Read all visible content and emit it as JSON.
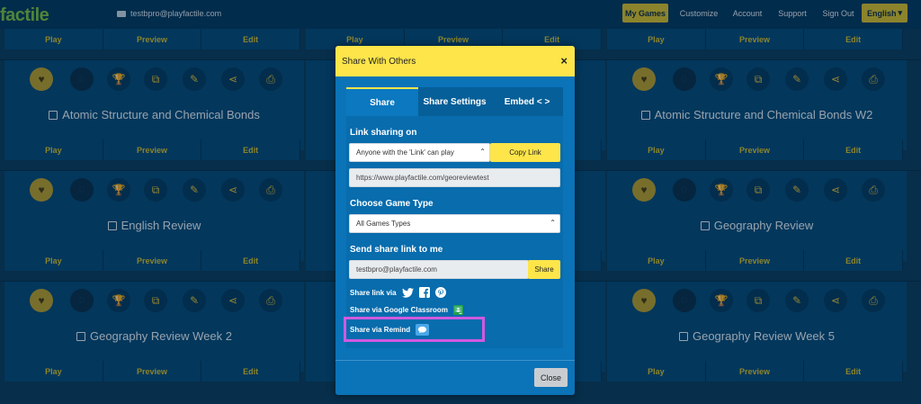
{
  "nav": {
    "logo": "factile",
    "email": "testbpro@playfactile.com",
    "links": [
      "My Games",
      "Customize",
      "Account",
      "Support",
      "Sign Out"
    ],
    "language": "English"
  },
  "card_actions": [
    "Play",
    "Preview",
    "Edit"
  ],
  "cards_left": [
    {
      "title": "Atomic Structure and Chemical Bonds"
    },
    {
      "title": "English Review"
    },
    {
      "title": "Geography Review Week 2"
    }
  ],
  "cards_right": [
    {
      "title": "Atomic Structure and Chemical Bonds W2"
    },
    {
      "title": "Geography Review"
    },
    {
      "title": "Geography Review Week 5"
    }
  ],
  "icons": [
    "heart-icon",
    "d-icon",
    "trophy-icon",
    "copy-icon",
    "edit-icon",
    "share-icon",
    "print-icon"
  ],
  "modal": {
    "title": "Share With Others",
    "close_symbol": "×",
    "tabs": [
      "Share",
      "Share Settings",
      "Embed < >"
    ],
    "link_sharing": {
      "heading": "Link sharing on",
      "select_value": "Anyone with the 'Link' can play",
      "copy_label": "Copy Link",
      "url": "https://www.playfactile.com/georeviewtest"
    },
    "game_type": {
      "heading": "Choose Game Type",
      "select_value": "All Games Types"
    },
    "send_link": {
      "heading": "Send share link to me",
      "email": "testbpro@playfactile.com",
      "share_label": "Share"
    },
    "share_link_via": "Share link via",
    "share_google": "Share via Google Classroom",
    "share_remind": "Share via Remind",
    "close_label": "Close"
  },
  "colors": {
    "accent": "#fde54a",
    "background": "#0b3c5d",
    "card": "#064a78",
    "highlight": "#d05ae0"
  }
}
